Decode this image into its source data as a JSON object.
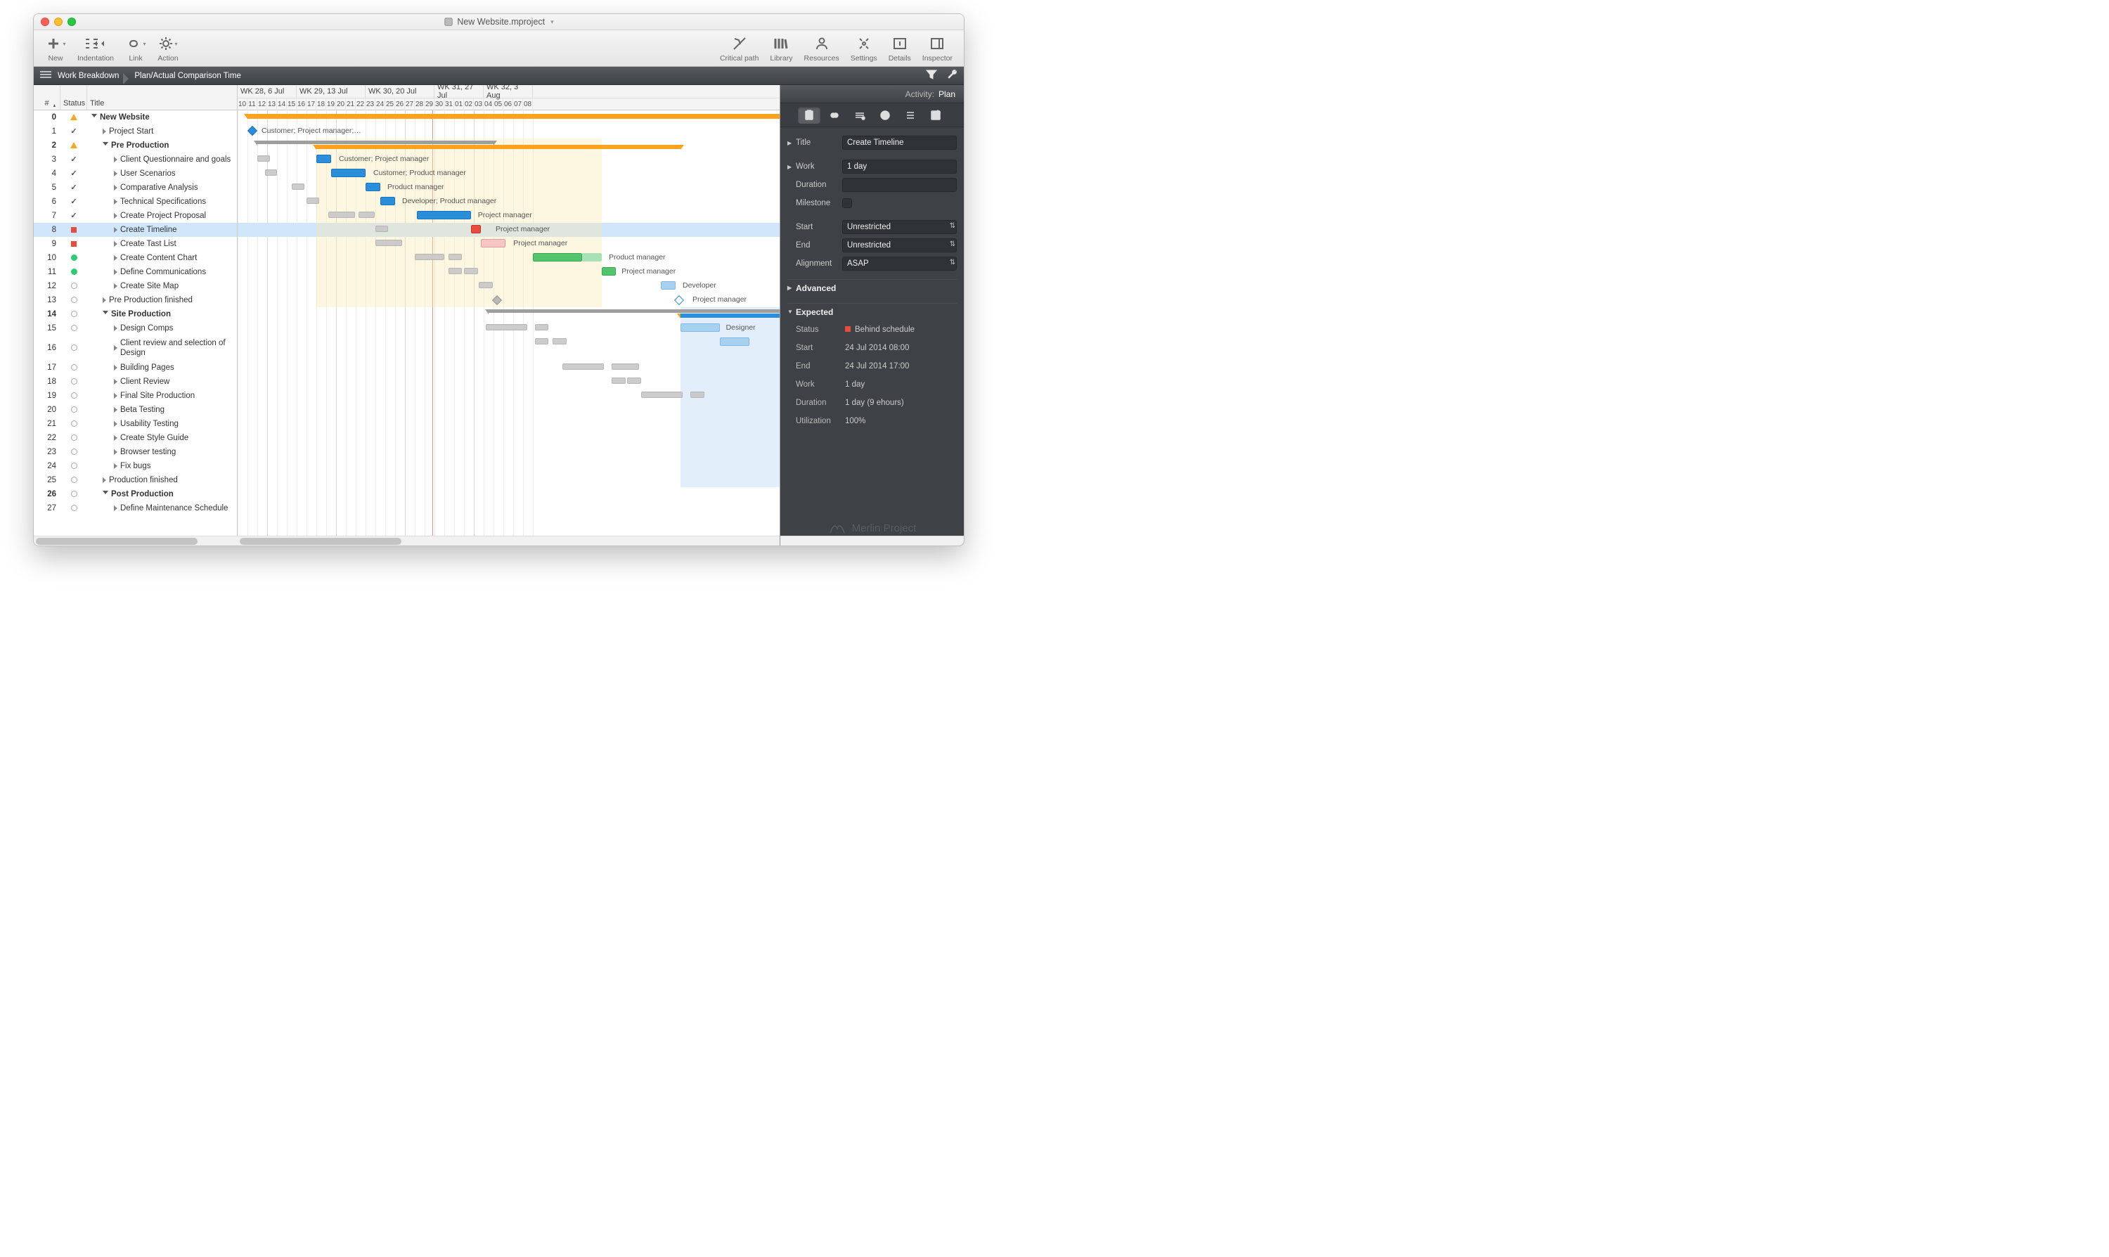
{
  "window": {
    "title": "New Website.mproject"
  },
  "toolbar": {
    "left": [
      {
        "label": "New"
      },
      {
        "label": "Indentation"
      },
      {
        "label": "Link"
      },
      {
        "label": "Action"
      }
    ],
    "right": [
      {
        "label": "Critical path"
      },
      {
        "label": "Library"
      },
      {
        "label": "Resources"
      },
      {
        "label": "Settings"
      },
      {
        "label": "Details"
      },
      {
        "label": "Inspector"
      }
    ]
  },
  "breadcrumb": {
    "a": "Work Breakdown",
    "b": "Plan/Actual Comparison Time"
  },
  "columns": {
    "hash": "#",
    "status": "Status",
    "title": "Title"
  },
  "weeks": [
    {
      "label": "WK 28, 6 Jul",
      "days": [
        "10",
        "11",
        "12",
        "13",
        "14",
        "15"
      ]
    },
    {
      "label": "WK 29, 13 Jul",
      "days": [
        "16",
        "17",
        "18",
        "19",
        "20",
        "21",
        "22"
      ]
    },
    {
      "label": "WK 30, 20 Jul",
      "days": [
        "23",
        "24",
        "25",
        "26",
        "27",
        "28",
        "29"
      ]
    },
    {
      "label": "WK 31, 27 Jul",
      "days": [
        "30",
        "31",
        "01",
        "02",
        "03"
      ]
    },
    {
      "label": "WK 32, 3 Aug",
      "days": [
        "04",
        "05",
        "06",
        "07",
        "08"
      ]
    }
  ],
  "selected_row": 8,
  "tasks": [
    {
      "n": 0,
      "status": "warn",
      "bold": true,
      "disc": "down",
      "indent": 0,
      "title": "New Website"
    },
    {
      "n": 1,
      "status": "check",
      "disc": "right",
      "indent": 1,
      "title": "Project Start"
    },
    {
      "n": 2,
      "status": "warn",
      "bold": true,
      "disc": "down",
      "indent": 1,
      "title": "Pre Production"
    },
    {
      "n": 3,
      "status": "check",
      "disc": "right",
      "indent": 2,
      "title": "Client Questionnaire and goals"
    },
    {
      "n": 4,
      "status": "check",
      "disc": "right",
      "indent": 2,
      "title": "User Scenarios"
    },
    {
      "n": 5,
      "status": "check",
      "disc": "right",
      "indent": 2,
      "title": "Comparative Analysis"
    },
    {
      "n": 6,
      "status": "check",
      "disc": "right",
      "indent": 2,
      "title": "Technical Specifications"
    },
    {
      "n": 7,
      "status": "check",
      "disc": "right",
      "indent": 2,
      "title": "Create Project Proposal"
    },
    {
      "n": 8,
      "status": "red",
      "disc": "right",
      "indent": 2,
      "title": "Create Timeline"
    },
    {
      "n": 9,
      "status": "red",
      "disc": "right",
      "indent": 2,
      "title": "Create Tast List"
    },
    {
      "n": 10,
      "status": "green",
      "disc": "right",
      "indent": 2,
      "title": "Create Content Chart"
    },
    {
      "n": 11,
      "status": "green",
      "disc": "right",
      "indent": 2,
      "title": "Define Communications"
    },
    {
      "n": 12,
      "status": "empty",
      "disc": "right",
      "indent": 2,
      "title": "Create Site Map"
    },
    {
      "n": 13,
      "status": "empty",
      "disc": "right",
      "indent": 1,
      "title": "Pre Production finished"
    },
    {
      "n": 14,
      "status": "empty",
      "bold": true,
      "disc": "down",
      "indent": 1,
      "title": "Site Production"
    },
    {
      "n": 15,
      "status": "empty",
      "disc": "right",
      "indent": 2,
      "title": "Design Comps"
    },
    {
      "n": 16,
      "status": "empty",
      "disc": "right",
      "indent": 2,
      "title": "Client review and selection of Design"
    },
    {
      "n": 17,
      "status": "empty",
      "disc": "right",
      "indent": 2,
      "title": "Building Pages"
    },
    {
      "n": 18,
      "status": "empty",
      "disc": "right",
      "indent": 2,
      "title": "Client Review"
    },
    {
      "n": 19,
      "status": "empty",
      "disc": "right",
      "indent": 2,
      "title": "Final Site Production"
    },
    {
      "n": 20,
      "status": "empty",
      "disc": "right",
      "indent": 2,
      "title": "Beta Testing"
    },
    {
      "n": 21,
      "status": "empty",
      "disc": "right",
      "indent": 2,
      "title": "Usability Testing"
    },
    {
      "n": 22,
      "status": "empty",
      "disc": "right",
      "indent": 2,
      "title": "Create Style Guide"
    },
    {
      "n": 23,
      "status": "empty",
      "disc": "right",
      "indent": 2,
      "title": "Browser testing"
    },
    {
      "n": 24,
      "status": "empty",
      "disc": "right",
      "indent": 2,
      "title": "Fix bugs"
    },
    {
      "n": 25,
      "status": "empty",
      "disc": "right",
      "indent": 1,
      "title": "Production finished"
    },
    {
      "n": 26,
      "status": "empty",
      "bold": true,
      "disc": "down",
      "indent": 1,
      "title": "Post Production"
    },
    {
      "n": 27,
      "status": "empty",
      "disc": "right",
      "indent": 2,
      "title": "Define Maintenance Schedule"
    }
  ],
  "bar_labels": {
    "1": "Customer; Project manager;…",
    "3": "Customer; Project manager",
    "4": "Customer; Product manager",
    "5": "Product manager",
    "6": "Developer; Product manager",
    "7": "Project manager",
    "8": "Project manager",
    "9": "Project manager",
    "10": "Product manager",
    "11": "Project manager",
    "12": "Developer",
    "13": "Project manager",
    "15": "Designer"
  },
  "inspector": {
    "header_l": "Activity:",
    "header_v": "Plan",
    "title_l": "Title",
    "title_v": "Create Timeline",
    "work_l": "Work",
    "work_v": "1 day",
    "duration_l": "Duration",
    "milestone_l": "Milestone",
    "start_l": "Start",
    "start_v": "Unrestricted",
    "end_l": "End",
    "end_v": "Unrestricted",
    "align_l": "Alignment",
    "align_v": "ASAP",
    "advanced_l": "Advanced",
    "expected_l": "Expected",
    "e_status_l": "Status",
    "e_status_v": "Behind schedule",
    "e_start_l": "Start",
    "e_start_v": "24 Jul 2014 08:00",
    "e_end_l": "End",
    "e_end_v": "24 Jul 2014 17:00",
    "e_work_l": "Work",
    "e_work_v": "1 day",
    "e_dur_l": "Duration",
    "e_dur_v": "1 day (9 ehours)",
    "e_util_l": "Utilization",
    "e_util_v": "100%",
    "brand": "Merlin Project"
  }
}
